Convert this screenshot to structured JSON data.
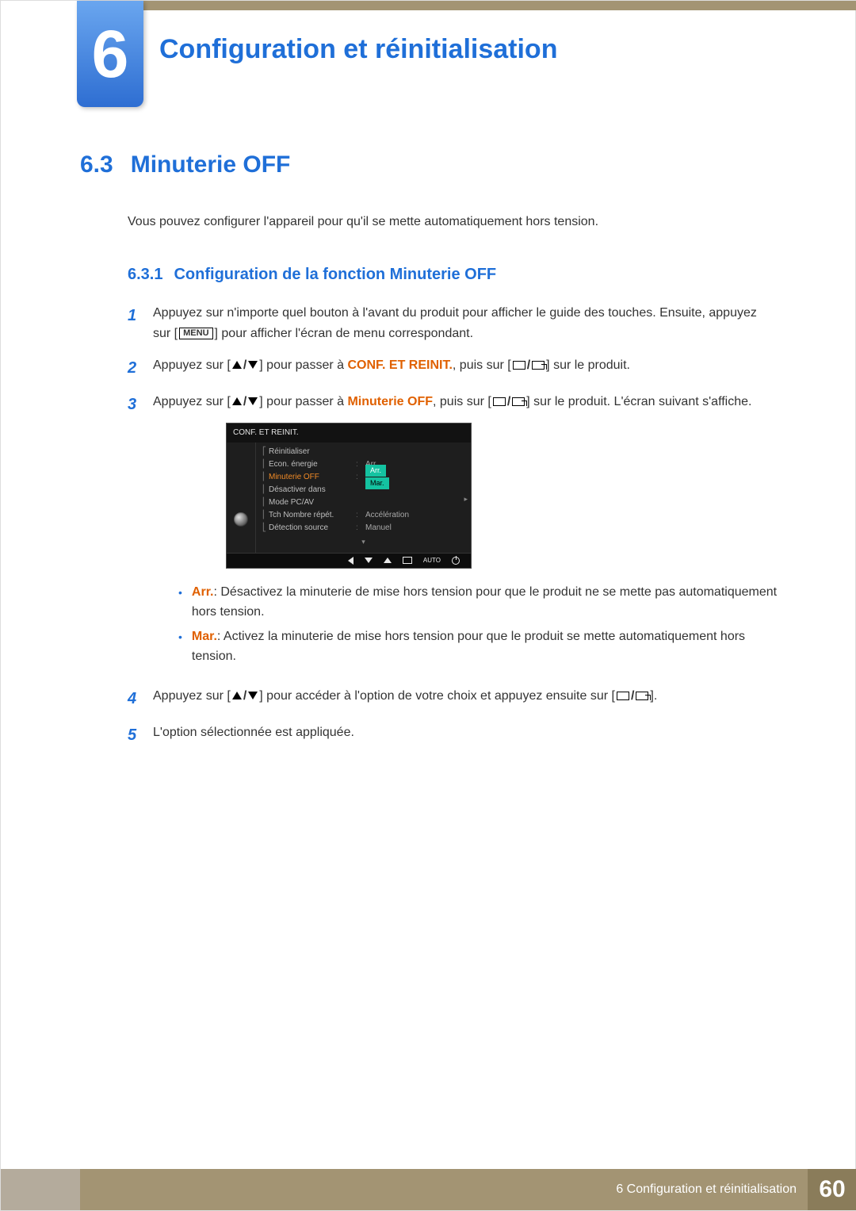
{
  "chapter": {
    "number": "6",
    "title": "Configuration et réinitialisation"
  },
  "section": {
    "number": "6.3",
    "title": "Minuterie OFF"
  },
  "intro": "Vous pouvez configurer l'appareil pour qu'il se mette automatiquement hors tension.",
  "subsection": {
    "number": "6.3.1",
    "title": "Configuration de la fonction Minuterie OFF"
  },
  "menu_button_label": "MENU",
  "steps": {
    "s1": {
      "num": "1",
      "t1": "Appuyez sur n'importe quel bouton à l'avant du produit pour afficher le guide des touches. Ensuite, appuyez sur [",
      "t2": "] pour afficher l'écran de menu correspondant."
    },
    "s2": {
      "num": "2",
      "t1": "Appuyez sur [",
      "t2": "] pour passer à ",
      "hl": "CONF. ET REINIT.",
      "t3": ", puis sur [",
      "t4": "] sur le produit."
    },
    "s3": {
      "num": "3",
      "t1": "Appuyez sur [",
      "t2": "] pour passer à ",
      "hl": "Minuterie OFF",
      "t3": ", puis sur [",
      "t4": "] sur le produit. L'écran suivant s'affiche."
    },
    "s4": {
      "num": "4",
      "t1": "Appuyez sur [",
      "t2": "] pour accéder à l'option de votre choix et appuyez ensuite sur [",
      "t3": "]."
    },
    "s5": {
      "num": "5",
      "t": "L'option sélectionnée est appliquée."
    }
  },
  "osd": {
    "title": "CONF. ET REINIT.",
    "rows": {
      "r0": {
        "label": "Réinitialiser",
        "val": ""
      },
      "r1": {
        "label": "Econ. énergie",
        "val": "Arr."
      },
      "r2": {
        "label": "Minuterie OFF",
        "opt1": "Arr.",
        "opt2": "Mar."
      },
      "r3": {
        "label": "Désactiver dans",
        "val": ""
      },
      "r4": {
        "label": "Mode PC/AV",
        "val": ""
      },
      "r5": {
        "label": "Tch Nombre répét.",
        "val": "Accélération"
      },
      "r6": {
        "label": "Détection source",
        "val": "Manuel"
      }
    },
    "footer_auto": "AUTO"
  },
  "bullets": {
    "b1": {
      "hl": "Arr.",
      "t": ": Désactivez la minuterie de mise hors tension pour que le produit ne se mette pas automatiquement hors tension."
    },
    "b2": {
      "hl": "Mar.",
      "t": ": Activez la minuterie de mise hors tension pour que le produit se mette automatiquement hors tension."
    }
  },
  "footer": {
    "text": "6 Configuration et réinitialisation",
    "page": "60"
  }
}
